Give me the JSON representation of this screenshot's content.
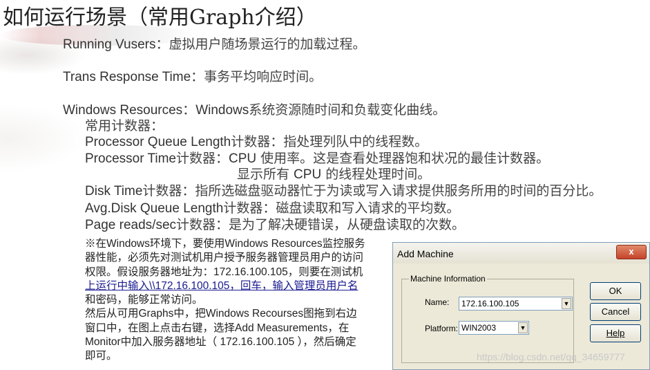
{
  "title": "如何运行场景（常用Graph介绍）",
  "items": {
    "running_vusers": {
      "term": "Running Vusers",
      "desc": "：虚拟用户随场景运行的加载过程。"
    },
    "trans_response": {
      "term": "Trans Response Time",
      "desc": "：事务平均响应时间。"
    },
    "windows_resources": {
      "term": "Windows Resources",
      "sep": "：",
      "term2": "Windows",
      "desc": "系统资源随时间和负载变化曲线。"
    },
    "common_counters": "常用计数器：",
    "processor_queue": {
      "term": "Processor Queue Length",
      "desc": "计数器：指处理列队中的线程数。"
    },
    "processor_time": {
      "term": "Processor Time",
      "desc1": "计数器：",
      "cpu": "CPU",
      "desc2": " 使用率。这是查看处理器饱和状况的最佳计数器。"
    },
    "processor_time_cont": {
      "prefix": "显示所有 ",
      "cpu": "CPU",
      "desc": " 的线程处理时间。"
    },
    "disk_time": {
      "term": "Disk Time",
      "desc": "计数器：指所选磁盘驱动器忙于为读或写入请求提供服务所用的时间的百分比。"
    },
    "avg_disk_queue": {
      "term": "Avg.Disk Queue Length",
      "desc": "计数器：磁盘读取和写入请求的平均数。"
    },
    "page_reads": {
      "term": "Page reads/sec",
      "desc": "计数器：是为了解决硬错误，从硬盘读取的次数。"
    }
  },
  "note": {
    "line1": "※在Windows环境下，要使用Windows Resources监控服务",
    "line2": "器性能，必须先对测试机用户授予服务器管理员用户的访问",
    "line3": "权限。假设服务器地址为：172.16.100.105，则要在测试机",
    "line4a": "上运行中输入",
    "line4b": "\\\\172.16.100.105，回车，输入管理员用户名",
    "line5": "和密码，能够正常访问。",
    "line6": "然后从可用Graphs中，把Windows Recourses图拖到右边",
    "line7": "窗口中，在图上点击右键，选择Add Measurements，在",
    "line8": "Monitor中加入服务器地址（ 172.16.100.105 ），然后确定",
    "line9": "即可。"
  },
  "dialog": {
    "title": "Add Machine",
    "close_label": "x",
    "group_label": "Machine Information",
    "name_label": "Name:",
    "name_value": "172.16.100.105",
    "platform_label": "Platform:",
    "platform_value": "WIN2003",
    "ok_label": "OK",
    "cancel_label": "Cancel",
    "help_label": "Help"
  },
  "watermark": "https://blog.csdn.net/qq_34659777"
}
